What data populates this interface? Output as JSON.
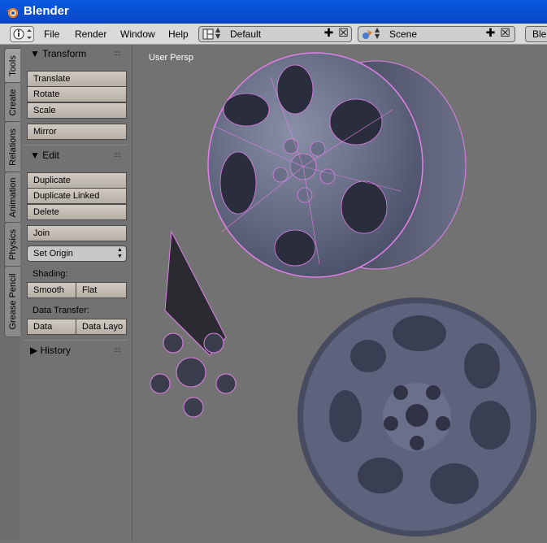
{
  "window": {
    "title": "Blender"
  },
  "menubar": {
    "menus": [
      "File",
      "Render",
      "Window",
      "Help"
    ],
    "screen_layout": "Default",
    "scene": "Scene",
    "engine_partial": "Ble"
  },
  "tabs": [
    "Tools",
    "Create",
    "Relations",
    "Animation",
    "Physics",
    "Grease Pencil"
  ],
  "toolshelf": {
    "transform": {
      "title": "Transform",
      "translate": "Translate",
      "rotate": "Rotate",
      "scale": "Scale",
      "mirror": "Mirror"
    },
    "edit": {
      "title": "Edit",
      "duplicate": "Duplicate",
      "duplicate_linked": "Duplicate Linked",
      "delete": "Delete",
      "join": "Join",
      "set_origin": "Set Origin",
      "shading_label": "Shading:",
      "smooth": "Smooth",
      "flat": "Flat",
      "data_transfer_label": "Data Transfer:",
      "data": "Data",
      "data_layout": "Data Layo"
    },
    "history": {
      "title": "History"
    }
  },
  "viewport": {
    "label": "User Persp"
  },
  "colors": {
    "titlebar": "#0a5ae0",
    "viewport": "#727272",
    "selection": "#e080e8",
    "mesh": "#5a6080"
  }
}
